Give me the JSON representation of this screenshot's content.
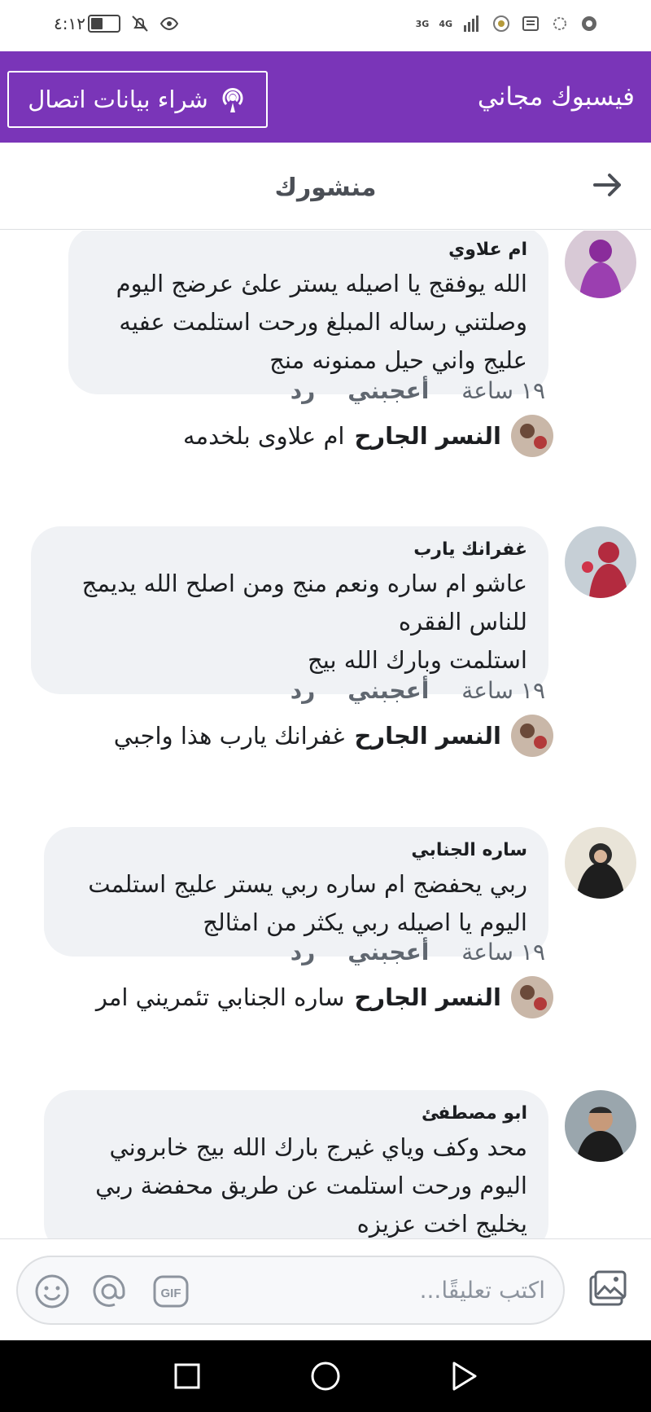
{
  "status_bar": {
    "time": "٤:١٢",
    "network_1": "4G",
    "network_2": "3G"
  },
  "topbar": {
    "app_title": "فيسبوك مجاني",
    "buy_data_label": "شراء بيانات اتصال",
    "background": "#7a35b8"
  },
  "header": {
    "title": "منشورك",
    "back_icon": "arrow-right-icon"
  },
  "comments": [
    {
      "author": "ام علاوي",
      "text": "الله يوفقج يا اصيله يستر علئ عرضج اليوم\nوصلتني رساله المبلغ ورحت استلمت عفيه\nعليج واني حيل ممنونه منج",
      "time": "١٩ ساعة",
      "like": "أعجبني",
      "reply": "رد",
      "reply_author": "النسر الجارح",
      "reply_text": "ام علاوى بلخدمه"
    },
    {
      "author": "غفرانك يارب",
      "text": "عاشو ام ساره ونعم منج  ومن اصلح الله يديمج\nللناس الفقره\nاستلمت وبارك الله بيج",
      "time": "١٩ ساعة",
      "like": "أعجبني",
      "reply": "رد",
      "reply_author": "النسر الجارح",
      "reply_text": "غفرانك يارب هذا واجبي"
    },
    {
      "author": "ساره الجنابي",
      "text": "ربي يحفضج ام ساره ربي يستر عليج استلمت\nاليوم يا اصيله ربي يكثر من امثالج",
      "time": "١٩ ساعة",
      "like": "أعجبني",
      "reply": "رد",
      "reply_author": "النسر الجارح",
      "reply_text": "ساره الجنابي تئمريني امر"
    },
    {
      "author": "ابو مصطفئ",
      "text": "محد وكف وياي غيرج بارك الله بيج خابروني\nاليوم ورحت استلمت عن طريق محفضة ربي\nيخليج اخت عزيزه"
    }
  ],
  "composer": {
    "placeholder": "اكتب تعليقًا...",
    "gif_label": "GIF"
  }
}
